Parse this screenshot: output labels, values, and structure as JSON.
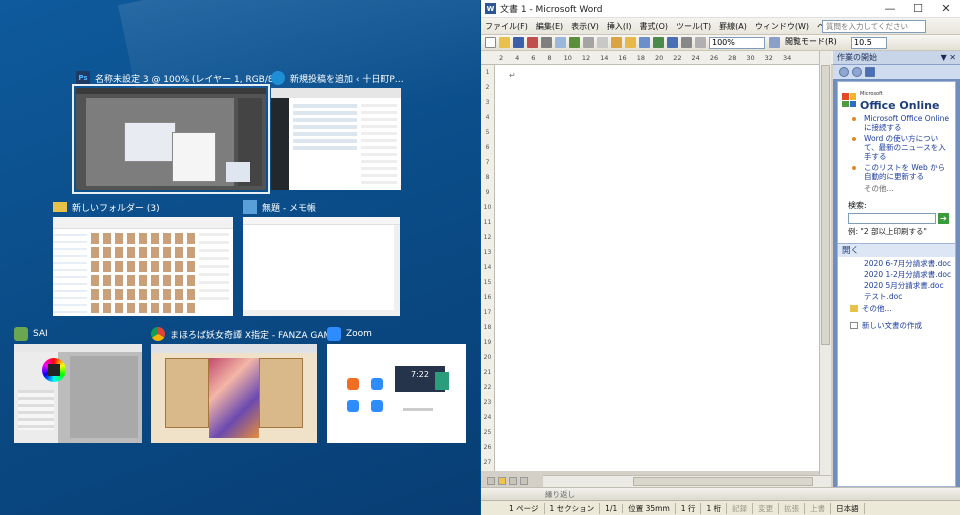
{
  "switcher": {
    "windows": [
      {
        "title": "名称未設定 3 @ 100% (レイヤー 1, RGB/8) *",
        "icon": "photoshop-icon",
        "icon_text": "Ps",
        "color": "#1f3b63"
      },
      {
        "title": "新規投稿を追加 ‹ 十日町P…",
        "icon": "edge-icon",
        "icon_text": "e",
        "color": "#1e8fd4"
      },
      {
        "title": "新しいフォルダー (3)",
        "icon": "folder-icon",
        "icon_text": "",
        "color": "#e7c14a"
      },
      {
        "title": "無題 - メモ帳",
        "icon": "notepad-icon",
        "icon_text": "",
        "color": "#5aa0d8"
      },
      {
        "title": "SAI",
        "icon": "sai-icon",
        "icon_text": "",
        "color": "#6aa84f"
      },
      {
        "title": "まほろば妖女奇譚 X指定 - FANZA GAM…",
        "icon": "chrome-icon",
        "icon_text": "",
        "color": "#db4437"
      },
      {
        "title": "Zoom",
        "icon": "zoom-icon",
        "icon_text": "",
        "color": "#2d8cff"
      }
    ],
    "zoom_time": "7:22"
  },
  "word": {
    "title": "文書 1 - Microsoft Word",
    "window_controls": [
      "—",
      "☐",
      "✕"
    ],
    "menus": [
      "ファイル(F)",
      "編集(E)",
      "表示(V)",
      "挿入(I)",
      "書式(O)",
      "ツール(T)",
      "罫線(A)",
      "ウィンドウ(W)",
      "ヘルプ(H)"
    ],
    "ask_placeholder": "質問を入力してください",
    "zoom": "100%",
    "reading_mode": "閲覧モード(R)",
    "font_size": "10.5",
    "ruler_numbers": [
      "2",
      "4",
      "6",
      "8",
      "10",
      "12",
      "14",
      "16",
      "18",
      "20",
      "22",
      "24",
      "26",
      "28",
      "30",
      "32",
      "34"
    ],
    "vruler_numbers": [
      "1",
      "2",
      "3",
      "4",
      "5",
      "6",
      "7",
      "8",
      "9",
      "10",
      "11",
      "12",
      "13",
      "14",
      "15",
      "16",
      "17",
      "18",
      "19",
      "20",
      "21",
      "22",
      "23",
      "24",
      "25",
      "26",
      "27"
    ],
    "paragraph_mark": "↵",
    "task_pane": {
      "title": "作業の開始",
      "logo_small": "Microsoft",
      "logo": "Office Online",
      "links": [
        "Microsoft Office Online に接続する",
        "Word の使い方について、最新のニュースを入手する",
        "このリストを Web から自動的に更新する"
      ],
      "more": "その他...",
      "search_label": "検索:",
      "example": "例: \"2 部以上印刷する\"",
      "open_header": "開く",
      "recent_files": [
        "2020 6-7月分請求書.doc",
        "2020 1-2月分請求書.doc",
        "2020 5月分請求書.doc",
        "テスト.doc"
      ],
      "open_more": "その他...",
      "new_doc": "新しい文書の作成"
    },
    "draw_label": "縁り返し",
    "status": [
      "1 ページ",
      "1 セクション",
      "1/1",
      "位置 35mm",
      "1 行",
      "1 桁"
    ],
    "status_dim": [
      "記録",
      "変更",
      "拡張",
      "上書"
    ],
    "language": "日本語"
  }
}
